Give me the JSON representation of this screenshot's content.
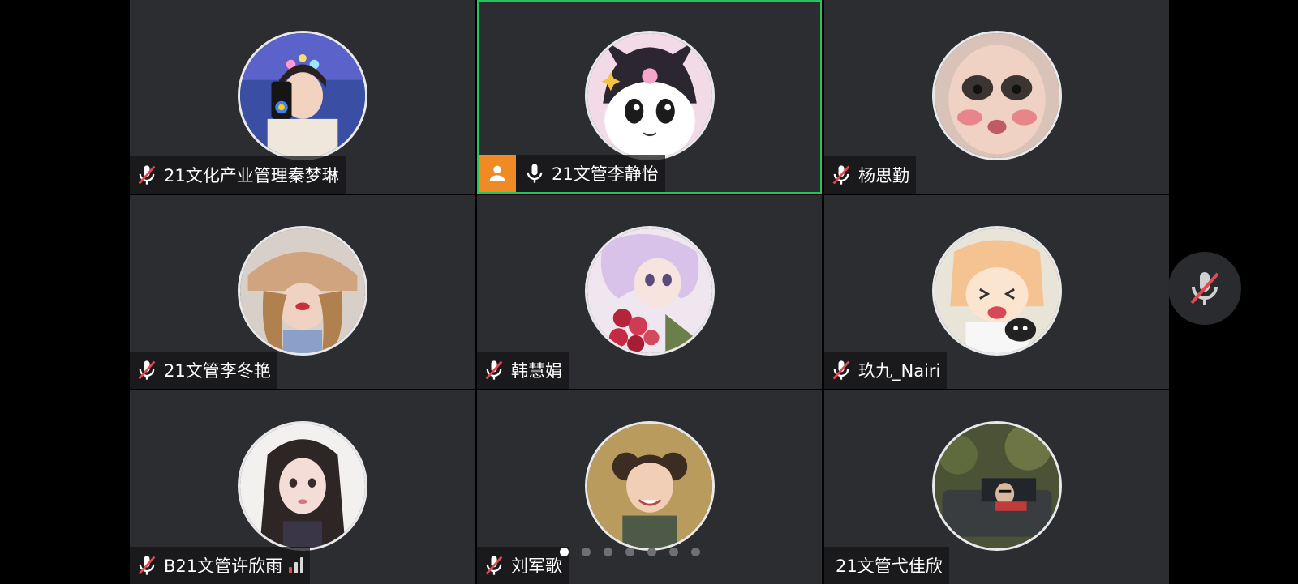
{
  "participants": [
    {
      "name": "21文化产业管理秦梦琳",
      "muted": true,
      "active": false,
      "host": false,
      "signal": false,
      "mic_shown": true
    },
    {
      "name": "21文管李静怡",
      "muted": false,
      "active": true,
      "host": true,
      "signal": false,
      "mic_shown": true
    },
    {
      "name": "杨思勤",
      "muted": true,
      "active": false,
      "host": false,
      "signal": false,
      "mic_shown": true
    },
    {
      "name": "21文管李冬艳",
      "muted": true,
      "active": false,
      "host": false,
      "signal": false,
      "mic_shown": true
    },
    {
      "name": "韩慧娟",
      "muted": true,
      "active": false,
      "host": false,
      "signal": false,
      "mic_shown": true
    },
    {
      "name": "玖九_Nairi",
      "muted": true,
      "active": false,
      "host": false,
      "signal": false,
      "mic_shown": true
    },
    {
      "name": "B21文管许欣雨",
      "muted": true,
      "active": false,
      "host": false,
      "signal": true,
      "mic_shown": true
    },
    {
      "name": "刘军歌",
      "muted": true,
      "active": false,
      "host": false,
      "signal": false,
      "mic_shown": true
    },
    {
      "name": "21文管弋佳欣",
      "muted": false,
      "active": false,
      "host": false,
      "signal": false,
      "mic_shown": false
    }
  ],
  "pagination": {
    "total": 7,
    "current": 1
  },
  "colors": {
    "tile_bg": "#2b2d31",
    "active_border": "#22c55e",
    "host_badge": "#f08a24",
    "muted_slash": "#e5484d",
    "signal_strong": "#e5484d"
  }
}
